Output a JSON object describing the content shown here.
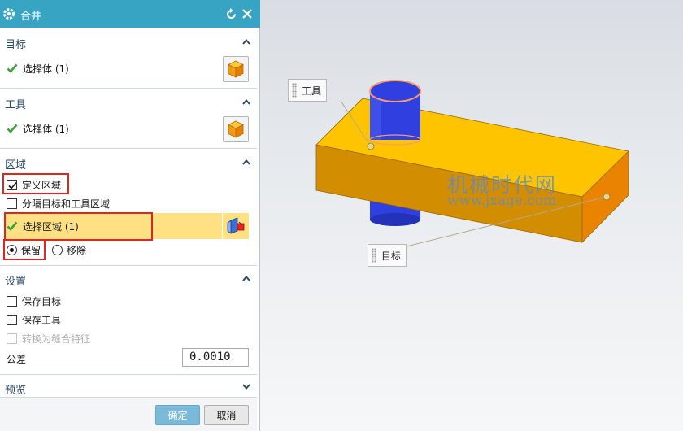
{
  "dialog": {
    "title": "合并",
    "icons": [
      "gear-icon",
      "reset-icon",
      "close-icon"
    ],
    "target_section": {
      "header": "目标",
      "select_label": "选择体 (1)"
    },
    "tool_section": {
      "header": "工具",
      "select_label": "选择体 (1)"
    },
    "region_section": {
      "header": "区域",
      "define_region": {
        "label": "定义区域",
        "checked": true
      },
      "separate_region": {
        "label": "分隔目标和工具区域",
        "checked": false
      },
      "select_region": "选择区域 (1)",
      "keep": {
        "label": "保留",
        "selected": true
      },
      "remove": {
        "label": "移除",
        "selected": false
      }
    },
    "settings_section": {
      "header": "设置",
      "keep_target": {
        "label": "保存目标",
        "checked": false
      },
      "keep_tool": {
        "label": "保存工具",
        "checked": false
      },
      "convert_seam": {
        "label": "转换为缝合特征",
        "checked": false,
        "disabled": true
      },
      "tolerance_label": "公差",
      "tolerance_value": "0.0010"
    },
    "preview_section": {
      "header": "预览"
    },
    "ok_label": "确定",
    "cancel_label": "取消"
  },
  "viewport": {
    "tool_callout": "工具",
    "target_callout": "目标",
    "watermark_cn": "机械时代网",
    "watermark_url": "www.jxage.com"
  },
  "colors": {
    "titlebar": "#38a4c4",
    "highlight": "#ffe083",
    "annotation_red": "#e0261f",
    "box_top": "#ffc400",
    "box_front": "#ce8a00",
    "cylinder": "#2f3fe0"
  }
}
